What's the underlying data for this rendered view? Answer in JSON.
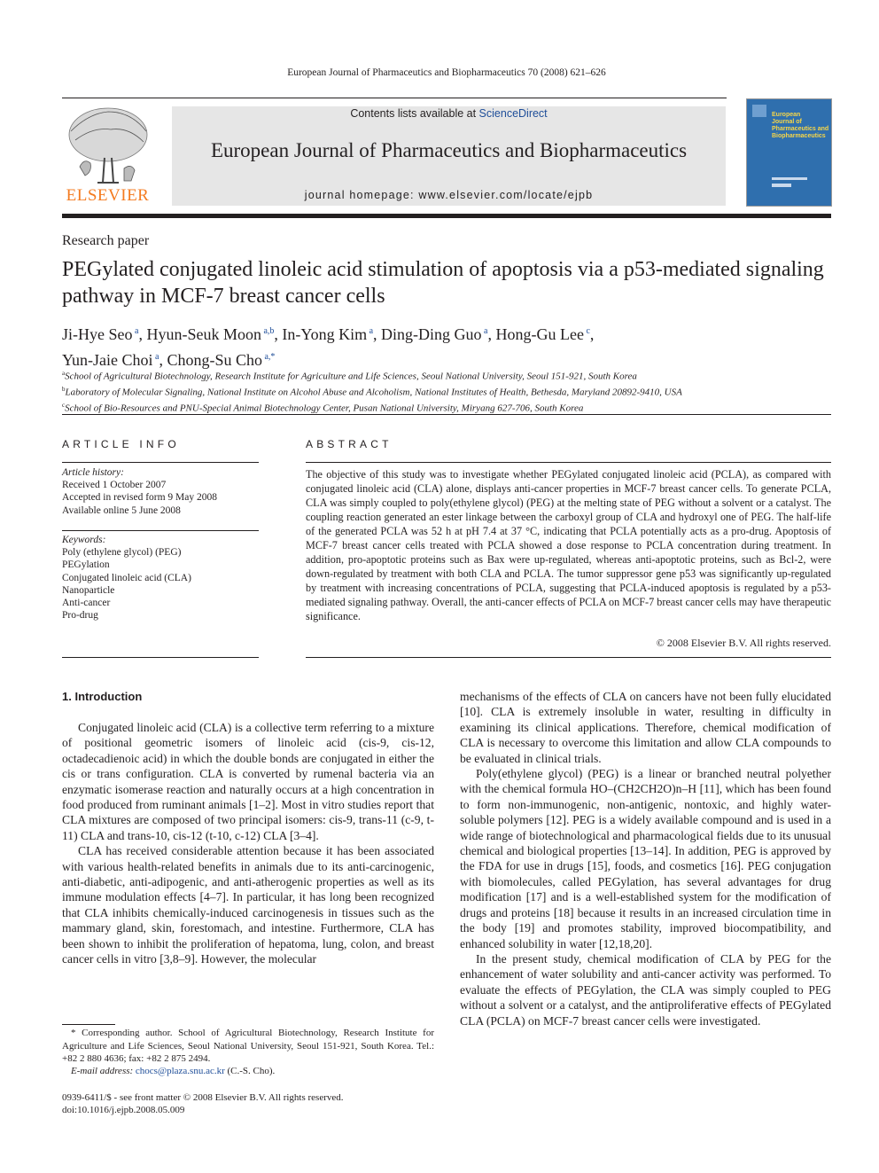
{
  "header": {
    "journal_reference": "European Journal of Pharmaceutics and Biopharmaceutics 70 (2008) 621–626",
    "contents_prefix": "Contents lists available at ",
    "contents_link": "ScienceDirect",
    "journal_title": "European Journal of Pharmaceutics and Biopharmaceutics",
    "homepage_prefix": "journal homepage: ",
    "homepage_url": "www.elsevier.com/locate/ejpb",
    "publisher_logo_text": "ELSEVIER",
    "cover_title_lines": [
      "European",
      "Journal of",
      "Pharmaceutics and",
      "Biopharmaceutics"
    ]
  },
  "article": {
    "type": "Research paper",
    "title": "PEGylated conjugated linoleic acid stimulation of apoptosis via a p53-mediated signaling pathway in MCF-7 breast cancer cells",
    "authors": [
      {
        "name": "Ji-Hye Seo",
        "sup": "a"
      },
      {
        "name": "Hyun-Seuk Moon",
        "sup": "a,b"
      },
      {
        "name": "In-Yong Kim",
        "sup": "a"
      },
      {
        "name": "Ding-Ding Guo",
        "sup": "a"
      },
      {
        "name": "Hong-Gu Lee",
        "sup": "c"
      },
      {
        "name": "Yun-Jaie Choi",
        "sup": "a"
      },
      {
        "name": "Chong-Su Cho",
        "sup": "a,*"
      }
    ],
    "affiliations": [
      {
        "sup": "a",
        "text": "School of Agricultural Biotechnology, Research Institute for Agriculture and Life Sciences, Seoul National University, Seoul 151-921, South Korea"
      },
      {
        "sup": "b",
        "text": "Laboratory of Molecular Signaling, National Institute on Alcohol Abuse and Alcoholism, National Institutes of Health, Bethesda, Maryland 20892-9410, USA"
      },
      {
        "sup": "c",
        "text": "School of Bio-Resources and PNU-Special Animal Biotechnology Center, Pusan National University, Miryang 627-706, South Korea"
      }
    ]
  },
  "article_info": {
    "heading": "ARTICLE INFO",
    "history_label": "Article history:",
    "history": [
      "Received 1 October 2007",
      "Accepted in revised form 9 May 2008",
      "Available online 5 June 2008"
    ],
    "keywords_label": "Keywords:",
    "keywords": [
      "Poly (ethylene glycol) (PEG)",
      "PEGylation",
      "Conjugated linoleic acid (CLA)",
      "Nanoparticle",
      "Anti-cancer",
      "Pro-drug"
    ]
  },
  "abstract": {
    "heading": "ABSTRACT",
    "text": "The objective of this study was to investigate whether PEGylated conjugated linoleic acid (PCLA), as compared with conjugated linoleic acid (CLA) alone, displays anti-cancer properties in MCF-7 breast cancer cells. To generate PCLA, CLA was simply coupled to poly(ethylene glycol) (PEG) at the melting state of PEG without a solvent or a catalyst. The coupling reaction generated an ester linkage between the carboxyl group of CLA and hydroxyl one of PEG. The half-life of the generated PCLA was 52 h at pH 7.4 at 37 °C, indicating that PCLA potentially acts as a pro-drug. Apoptosis of MCF-7 breast cancer cells treated with PCLA showed a dose response to PCLA concentration during treatment. In addition, pro-apoptotic proteins such as Bax were up-regulated, whereas anti-apoptotic proteins, such as Bcl-2, were down-regulated by treatment with both CLA and PCLA. The tumor suppressor gene p53 was significantly up-regulated by treatment with increasing concentrations of PCLA, suggesting that PCLA-induced apoptosis is regulated by a p53-mediated signaling pathway. Overall, the anti-cancer effects of PCLA on MCF-7 breast cancer cells may have therapeutic significance.",
    "copyright": "© 2008 Elsevier B.V. All rights reserved."
  },
  "body": {
    "section_heading": "1. Introduction",
    "left_paragraphs": [
      "Conjugated linoleic acid (CLA) is a collective term referring to a mixture of positional geometric isomers of linoleic acid (cis-9, cis-12, octadecadienoic acid) in which the double bonds are conjugated in either the cis or trans configuration. CLA is converted by rumenal bacteria via an enzymatic isomerase reaction and naturally occurs at a high concentration in food produced from ruminant animals [1–2]. Most in vitro studies report that CLA mixtures are composed of two principal isomers: cis-9, trans-11 (c-9, t-11) CLA and trans-10, cis-12 (t-10, c-12) CLA [3–4].",
      "CLA has received considerable attention because it has been associated with various health-related benefits in animals due to its anti-carcinogenic, anti-diabetic, anti-adipogenic, and anti-atherogenic properties as well as its immune modulation effects [4–7]. In particular, it has long been recognized that CLA inhibits chemically-induced carcinogenesis in tissues such as the mammary gland, skin, forestomach, and intestine. Furthermore, CLA has been shown to inhibit the proliferation of hepatoma, lung, colon, and breast cancer cells in vitro [3,8–9]. However, the molecular"
    ],
    "right_paragraphs": [
      "mechanisms of the effects of CLA on cancers have not been fully elucidated [10]. CLA is extremely insoluble in water, resulting in difficulty in examining its clinical applications. Therefore, chemical modification of CLA is necessary to overcome this limitation and allow CLA compounds to be evaluated in clinical trials.",
      "Poly(ethylene glycol) (PEG) is a linear or branched neutral polyether with the chemical formula HO–(CH2CH2O)n–H [11], which has been found to form non-immunogenic, non-antigenic, nontoxic, and highly water-soluble polymers [12]. PEG is a widely available compound and is used in a wide range of biotechnological and pharmacological fields due to its unusual chemical and biological properties [13–14]. In addition, PEG is approved by the FDA for use in drugs [15], foods, and cosmetics [16]. PEG conjugation with biomolecules, called PEGylation, has several advantages for drug modification [17] and is a well-established system for the modification of drugs and proteins [18] because it results in an increased circulation time in the body [19] and promotes stability, improved biocompatibility, and enhanced solubility in water [12,18,20].",
      "In the present study, chemical modification of CLA by PEG for the enhancement of water solubility and anti-cancer activity was performed. To evaluate the effects of PEGylation, the CLA was simply coupled to PEG without a solvent or a catalyst, and the antiproliferative effects of PEGylated CLA (PCLA) on MCF-7 breast cancer cells were investigated."
    ]
  },
  "footnote": {
    "corresponding": "* Corresponding author. School of Agricultural Biotechnology, Research Institute for Agriculture and Life Sciences, Seoul National University, Seoul 151-921, South Korea. Tel.: +82 2 880 4636; fax: +82 2 875 2494.",
    "email_label": "E-mail address: ",
    "email": "chocs@plaza.snu.ac.kr",
    "email_suffix": " (C.-S. Cho)."
  },
  "bottom": {
    "issn_line": "0939-6411/$ - see front matter © 2008 Elsevier B.V. All rights reserved.",
    "doi_line": "doi:10.1016/j.ejpb.2008.05.009"
  }
}
